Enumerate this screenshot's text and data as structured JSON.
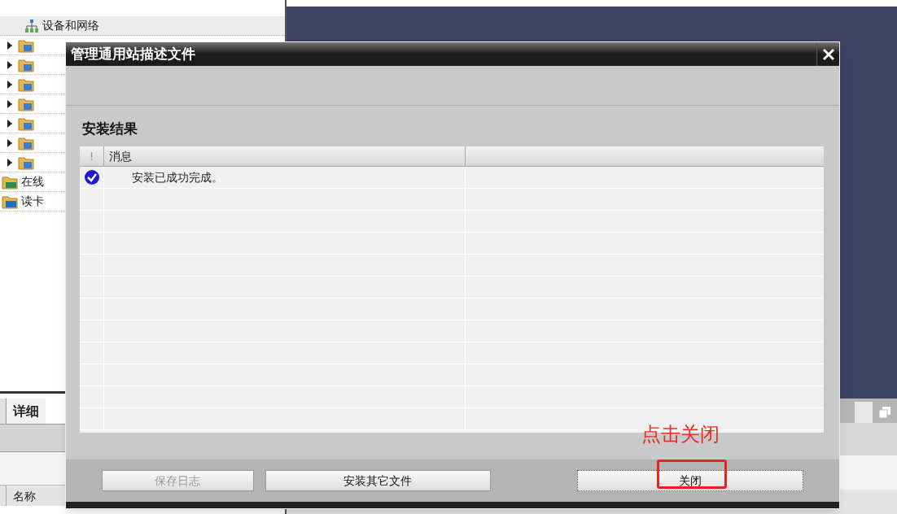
{
  "tree": {
    "items": [
      {
        "kind": "network",
        "label": "设备和网络"
      },
      {
        "kind": "folder",
        "expanded": false
      },
      {
        "kind": "folder",
        "expanded": false
      },
      {
        "kind": "folder",
        "expanded": false
      },
      {
        "kind": "folder",
        "expanded": false
      },
      {
        "kind": "folder",
        "expanded": false
      },
      {
        "kind": "folder",
        "expanded": false
      },
      {
        "kind": "folder",
        "expanded": false
      },
      {
        "kind": "online",
        "label": "在线"
      },
      {
        "kind": "card",
        "label": "读卡"
      }
    ]
  },
  "details_tab": "详细",
  "name_column": "名称",
  "dialog": {
    "title": "管理通用站描述文件",
    "section_title": "安装结果",
    "table": {
      "columns": [
        "!",
        "消息"
      ],
      "rows": [
        {
          "kind": "success",
          "message": "安装已成功完成。"
        }
      ]
    },
    "buttons": [
      {
        "label": "保存日志",
        "disabled": true,
        "focused": false
      },
      {
        "label": "安装其它文件",
        "disabled": false,
        "focused": false
      },
      {
        "label": "关闭",
        "disabled": false,
        "focused": true
      }
    ]
  },
  "annotation": {
    "text": "点击关闭"
  }
}
